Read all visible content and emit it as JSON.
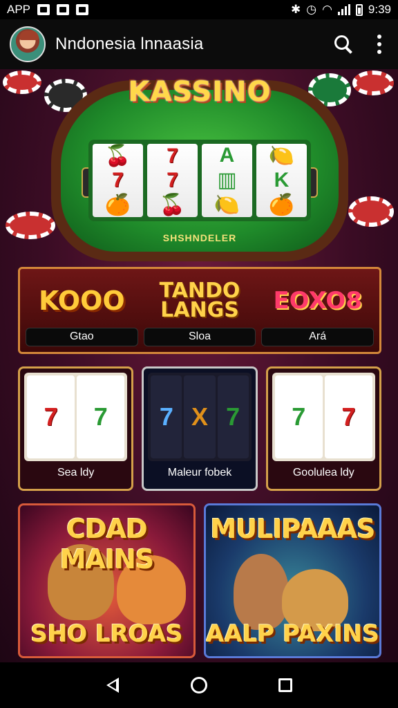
{
  "status_bar": {
    "left_label": "APP",
    "time": "9:39",
    "icons": [
      "image-icon",
      "mail-icon",
      "download-icon",
      "bluetooth-icon",
      "alarm-icon",
      "wifi-icon",
      "signal-icon",
      "battery-icon"
    ]
  },
  "app_bar": {
    "title": "Nndonesia lnnaasia",
    "icons": [
      "avatar",
      "search-icon",
      "more-vert-icon"
    ]
  },
  "hero": {
    "title": "KASSINO",
    "caption": "SHSHNDELER",
    "reels": [
      [
        "🍒",
        "7",
        "🍊"
      ],
      [
        "7",
        "7",
        "🍒"
      ],
      [
        "A",
        "▥",
        "🍋"
      ],
      [
        "🍋",
        "K",
        "🍊"
      ]
    ]
  },
  "categories": [
    {
      "logo": "KOOO",
      "label": "Gtao"
    },
    {
      "logo": "TANDO LANGS",
      "label": "Sloa"
    },
    {
      "logo": "EOXO8",
      "label": "Ará"
    }
  ],
  "slots": [
    {
      "label": "Sea ldy",
      "symbols": [
        "7",
        "7"
      ]
    },
    {
      "label": "Maleur fobek",
      "symbols": [
        "7",
        "X",
        "7"
      ]
    },
    {
      "label": "Goolulea ldy",
      "symbols": [
        "7",
        "7"
      ]
    }
  ],
  "featured": [
    {
      "top": "CDAD MAINS",
      "bottom": "SHO LROAS"
    },
    {
      "top": "MULIPAAAS",
      "bottom": "AALP PAXINS"
    }
  ],
  "colors": {
    "background": "#3a0c24",
    "gold": "#ffd24a",
    "felt": "#2a9a34",
    "accent_red": "#d32020"
  }
}
